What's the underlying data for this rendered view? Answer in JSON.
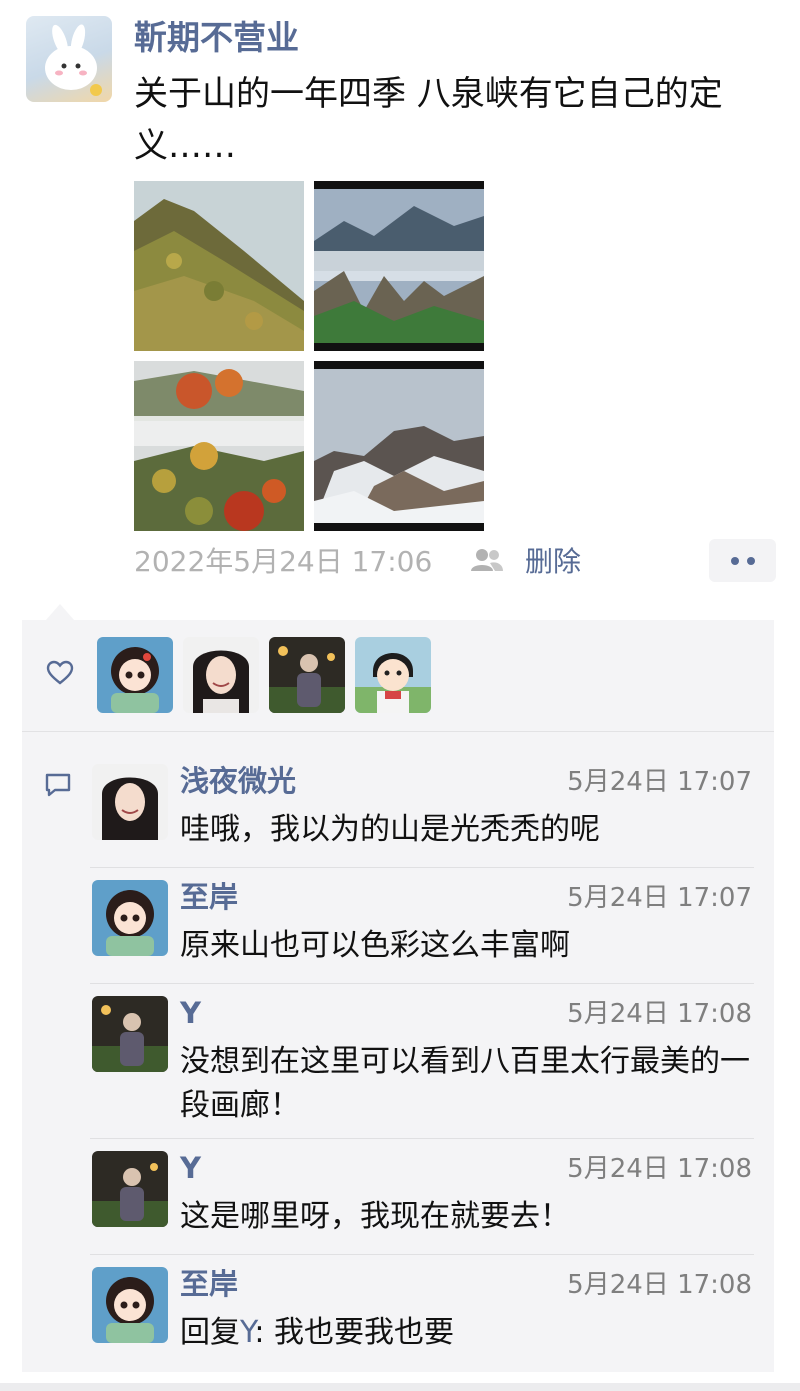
{
  "post": {
    "poster_name": "靳期不营业",
    "text": "关于山的一年四季 八泉峡有它自己的定义……",
    "timestamp": "2022年5月24日 17:06",
    "delete_label": "删除",
    "photo_count": 4
  },
  "icons": {
    "visibility": "people-icon",
    "more": "more-dots-icon",
    "like": "heart-icon",
    "comment": "comment-icon"
  },
  "likes": [
    "至岸",
    "浅夜微光",
    "Y",
    "静香头像"
  ],
  "comments": [
    {
      "name": "浅夜微光",
      "time": "5月24日 17:07",
      "text": "哇哦，我以为的山是光秃秃的呢"
    },
    {
      "name": "至岸",
      "time": "5月24日 17:07",
      "text": "原来山也可以色彩这么丰富啊"
    },
    {
      "name": "Y",
      "time": "5月24日 17:08",
      "text": "没想到在这里可以看到八百里太行最美的一段画廊！"
    },
    {
      "name": "Y",
      "time": "5月24日 17:08",
      "text": "这是哪里呀，我现在就要去！"
    },
    {
      "name": "至岸",
      "time": "5月24日 17:08",
      "reply_prefix": "回复",
      "reply_to": "Y",
      "reply_text": ": 我也要我也要"
    }
  ],
  "colors": {
    "link": "#576b95",
    "panel": "#f4f4f6",
    "meta": "#b2b2b2"
  }
}
